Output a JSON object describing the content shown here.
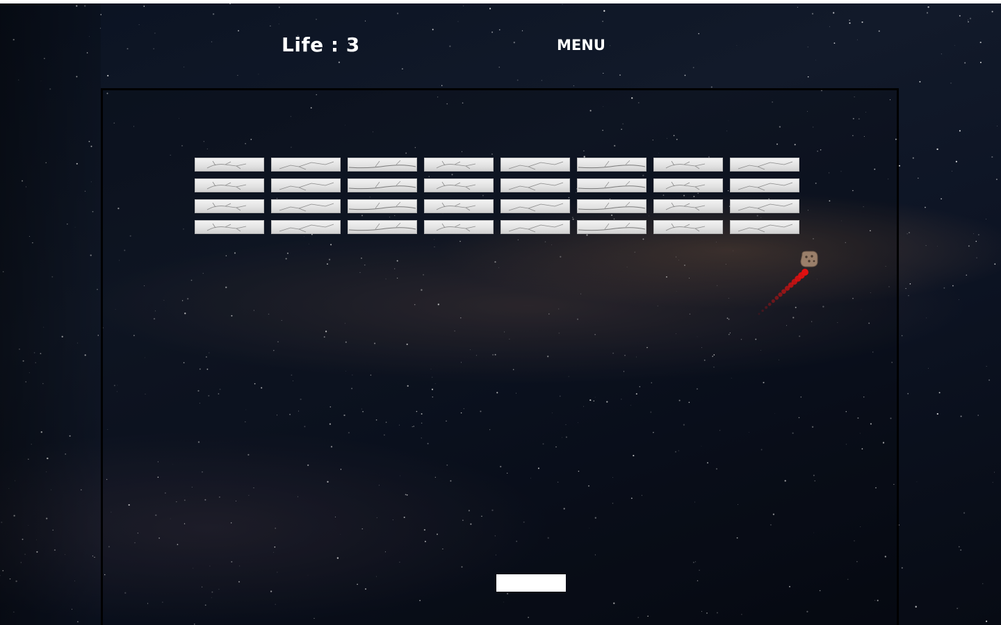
{
  "hud": {
    "life_text": "Life : 3",
    "menu_label": "MENU"
  },
  "game": {
    "lives": 3,
    "brick_rows": 4,
    "brick_columns": 8,
    "bricks_remaining": 32,
    "brick_color": "#e6e6e6",
    "paddle_color": "#ffffff",
    "ball_trail_color": "#e01010",
    "ball_color": "#9a7f6a"
  }
}
